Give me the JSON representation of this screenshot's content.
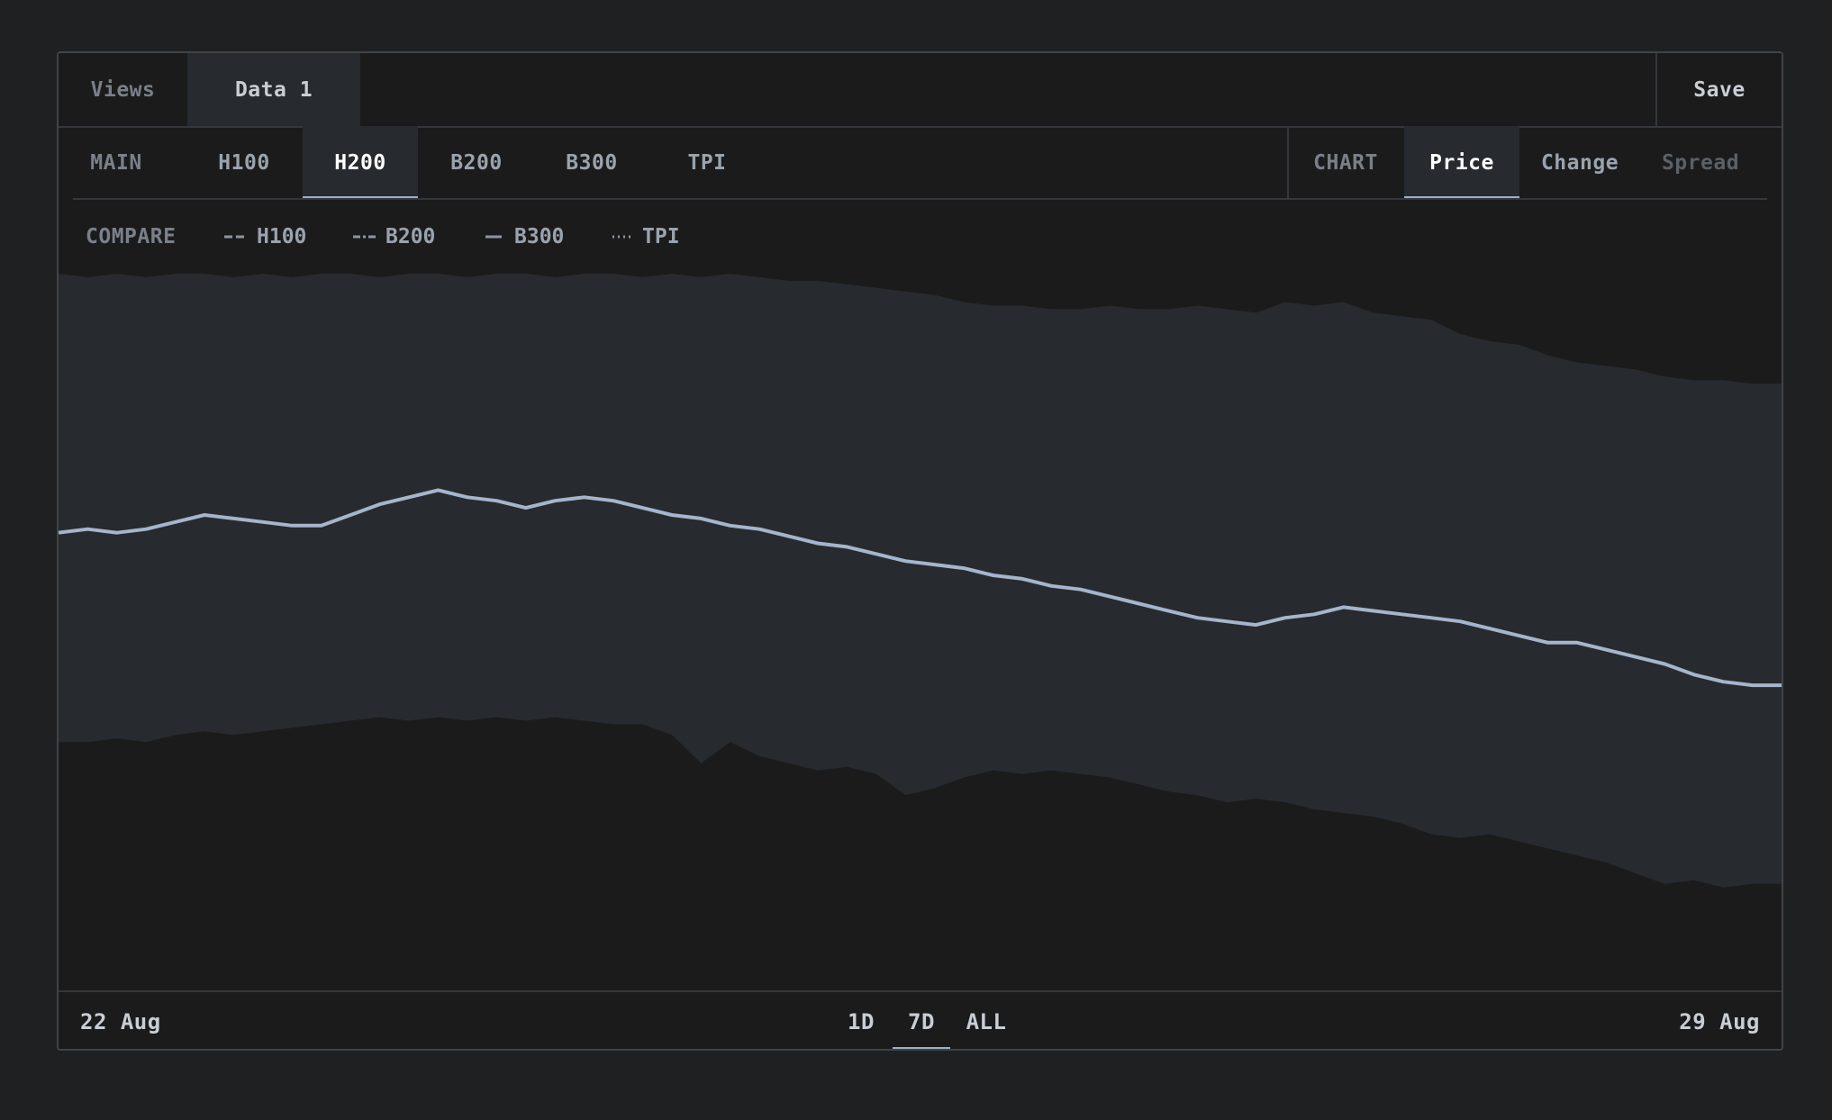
{
  "tabs": {
    "views_label": "Views",
    "data_label": "Data 1",
    "save_label": "Save"
  },
  "series_tabs": {
    "group_label": "MAIN",
    "items": [
      "H100",
      "H200",
      "B200",
      "B300",
      "TPI"
    ],
    "active": "H200"
  },
  "chart_modes": {
    "group_label": "CHART",
    "items": [
      "Price",
      "Change",
      "Spread"
    ],
    "active": "Price",
    "disabled": "Spread"
  },
  "compare": {
    "label": "COMPARE",
    "items": [
      {
        "name": "H100",
        "style": "dashed"
      },
      {
        "name": "B200",
        "style": "dash-dot"
      },
      {
        "name": "B300",
        "style": "solid"
      },
      {
        "name": "TPI",
        "style": "dotted"
      }
    ]
  },
  "footer": {
    "start_date": "22 Aug",
    "end_date": "29 Aug",
    "ranges": [
      "1D",
      "7D",
      "ALL"
    ],
    "active_range": "7D"
  },
  "colors": {
    "line": "#a4b5cc",
    "band": "#272a2e",
    "background": "#1b1b1c",
    "accent": "#9db0c9"
  },
  "chart_data": {
    "type": "area",
    "x": {
      "start": "22 Aug",
      "end": "29 Aug",
      "count": 60
    },
    "grid": false,
    "series": [
      {
        "role": "price",
        "values": [
          1.29,
          1.3,
          1.29,
          1.3,
          1.32,
          1.34,
          1.33,
          1.32,
          1.31,
          1.31,
          1.34,
          1.37,
          1.39,
          1.41,
          1.39,
          1.38,
          1.36,
          1.38,
          1.39,
          1.38,
          1.36,
          1.34,
          1.33,
          1.31,
          1.3,
          1.28,
          1.26,
          1.25,
          1.23,
          1.21,
          1.2,
          1.19,
          1.17,
          1.16,
          1.14,
          1.13,
          1.11,
          1.09,
          1.07,
          1.05,
          1.04,
          1.03,
          1.05,
          1.06,
          1.08,
          1.07,
          1.06,
          1.05,
          1.04,
          1.02,
          1.0,
          0.98,
          0.98,
          0.96,
          0.94,
          0.92,
          0.89,
          0.87,
          0.86,
          0.86
        ]
      },
      {
        "role": "upper-band",
        "values": [
          2.02,
          2.01,
          2.02,
          2.01,
          2.02,
          2.02,
          2.01,
          2.02,
          2.01,
          2.02,
          2.02,
          2.01,
          2.02,
          2.02,
          2.01,
          2.02,
          2.02,
          2.01,
          2.02,
          2.02,
          2.01,
          2.02,
          2.01,
          2.02,
          2.01,
          2.0,
          2.0,
          1.99,
          1.98,
          1.97,
          1.96,
          1.94,
          1.93,
          1.93,
          1.92,
          1.92,
          1.93,
          1.92,
          1.92,
          1.93,
          1.92,
          1.91,
          1.94,
          1.93,
          1.94,
          1.91,
          1.9,
          1.89,
          1.85,
          1.83,
          1.82,
          1.79,
          1.77,
          1.76,
          1.75,
          1.73,
          1.72,
          1.72,
          1.71,
          1.71
        ]
      },
      {
        "role": "lower-band",
        "values": [
          0.7,
          0.7,
          0.71,
          0.7,
          0.72,
          0.73,
          0.72,
          0.73,
          0.74,
          0.75,
          0.76,
          0.77,
          0.76,
          0.77,
          0.76,
          0.77,
          0.76,
          0.77,
          0.76,
          0.75,
          0.75,
          0.72,
          0.64,
          0.7,
          0.66,
          0.64,
          0.62,
          0.63,
          0.61,
          0.55,
          0.57,
          0.6,
          0.62,
          0.61,
          0.62,
          0.61,
          0.6,
          0.58,
          0.56,
          0.55,
          0.53,
          0.54,
          0.53,
          0.51,
          0.5,
          0.49,
          0.47,
          0.44,
          0.43,
          0.44,
          0.42,
          0.4,
          0.38,
          0.36,
          0.33,
          0.3,
          0.31,
          0.29,
          0.3,
          0.3
        ]
      }
    ],
    "ylim": [
      0,
      2.02
    ]
  }
}
